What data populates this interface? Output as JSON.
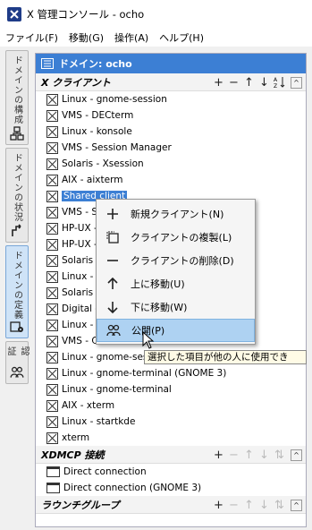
{
  "window": {
    "title": "X 管理コンソール - ocho"
  },
  "menubar": [
    "ファイル(F)",
    "移動(G)",
    "操作(A)",
    "ヘルプ(H)"
  ],
  "vtabs": [
    {
      "label": "ドメインの構成",
      "icon": "network-icon"
    },
    {
      "label": "ドメインの状況",
      "icon": "status-icon"
    },
    {
      "label": "ドメインの定義",
      "icon": "define-icon",
      "active": true
    },
    {
      "label": "認証",
      "icon": "users-icon"
    }
  ],
  "panel": {
    "title": "ドメイン: ocho"
  },
  "x_clients": {
    "title": "X クライアント",
    "items": [
      "Linux - gnome-session",
      "VMS - DECterm",
      "Linux - konsole",
      "VMS - Session Manager",
      "Solaris - Xsession",
      "AIX - aixterm",
      "Shared client",
      "VMS - S",
      "HP-UX -",
      "HP-UX -",
      "Solaris",
      "Linux -",
      "Solaris",
      "Digital -",
      "Linux -",
      "VMS - CDE",
      "Linux - gnome-session",
      "Linux - gnome-terminal (GNOME 3)",
      "Linux - gnome-terminal",
      "AIX - xterm",
      "Linux - startkde",
      "xterm"
    ],
    "selected_index": 6
  },
  "xdmcp": {
    "title": "XDMCP 接続",
    "items": [
      "Direct connection",
      "Direct connection (GNOME 3)"
    ]
  },
  "launcher_groups": {
    "title": "ラウンチグループ"
  },
  "context_menu": {
    "items": [
      {
        "label": "新規クライアント(N)",
        "icon": "plus-icon"
      },
      {
        "label": "クライアントの複製(L)",
        "icon": "copy-icon"
      },
      {
        "label": "クライアントの削除(D)",
        "icon": "minus-icon"
      },
      {
        "label": "上に移動(U)",
        "icon": "arrow-up-icon"
      },
      {
        "label": "下に移動(W)",
        "icon": "arrow-down-icon"
      },
      {
        "label": "公開(P)",
        "icon": "share-users-icon",
        "highlighted": true
      }
    ]
  },
  "tooltip": {
    "text": "選択した項目が他の人に使用でき"
  }
}
